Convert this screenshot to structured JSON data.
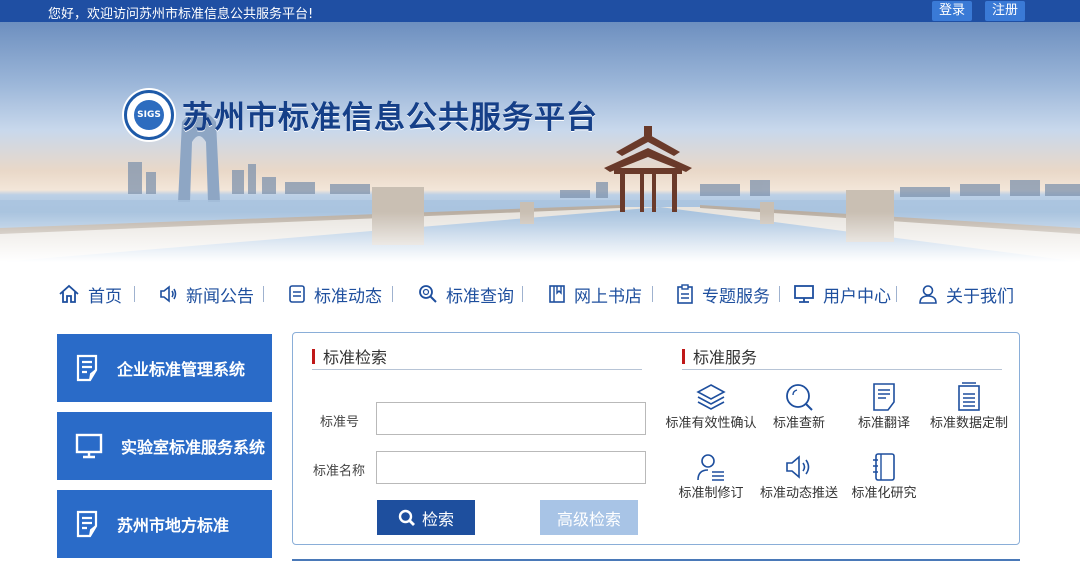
{
  "topbar": {
    "greeting": "您好，欢迎访问苏州市标准信息公共服务平台!",
    "login_label": "登录",
    "register_label": "注册",
    "accent": "#1f4fa3"
  },
  "banner": {
    "title": "苏州市标准信息公共服务平台",
    "logo_text": "SIGS"
  },
  "nav": {
    "items": [
      {
        "label": "首页",
        "icon": "home-icon"
      },
      {
        "label": "新闻公告",
        "icon": "speaker-icon"
      },
      {
        "label": "标准动态",
        "icon": "document-icon"
      },
      {
        "label": "标准查询",
        "icon": "search-icon"
      },
      {
        "label": "网上书店",
        "icon": "book-icon"
      },
      {
        "label": "专题服务",
        "icon": "clipboard-icon"
      },
      {
        "label": "用户中心",
        "icon": "monitor-icon"
      },
      {
        "label": "关于我们",
        "icon": "user-icon"
      }
    ]
  },
  "sidebar": {
    "items": [
      {
        "label": "企业标准管理系统",
        "icon": "document-edit-icon"
      },
      {
        "label": "实验室标准服务系统",
        "icon": "monitor-icon"
      },
      {
        "label": "苏州市地方标准",
        "icon": "document-edit-icon"
      }
    ],
    "color": "#2a6bc8"
  },
  "search": {
    "heading": "标准检索",
    "number_label": "标准号",
    "number_value": "",
    "name_label": "标准名称",
    "name_value": "",
    "search_button": "检索",
    "advanced_button": "高级检索"
  },
  "services": {
    "heading": "标准服务",
    "items": [
      {
        "label": "标准有效性确认",
        "icon": "layers-icon"
      },
      {
        "label": "标准查新",
        "icon": "search-icon"
      },
      {
        "label": "标准翻译",
        "icon": "document-edit-icon"
      },
      {
        "label": "标准数据定制",
        "icon": "file-list-icon"
      },
      {
        "label": "标准制修订",
        "icon": "user-list-icon"
      },
      {
        "label": "标准动态推送",
        "icon": "speaker-icon"
      },
      {
        "label": "标准化研究",
        "icon": "notebook-icon"
      }
    ]
  }
}
